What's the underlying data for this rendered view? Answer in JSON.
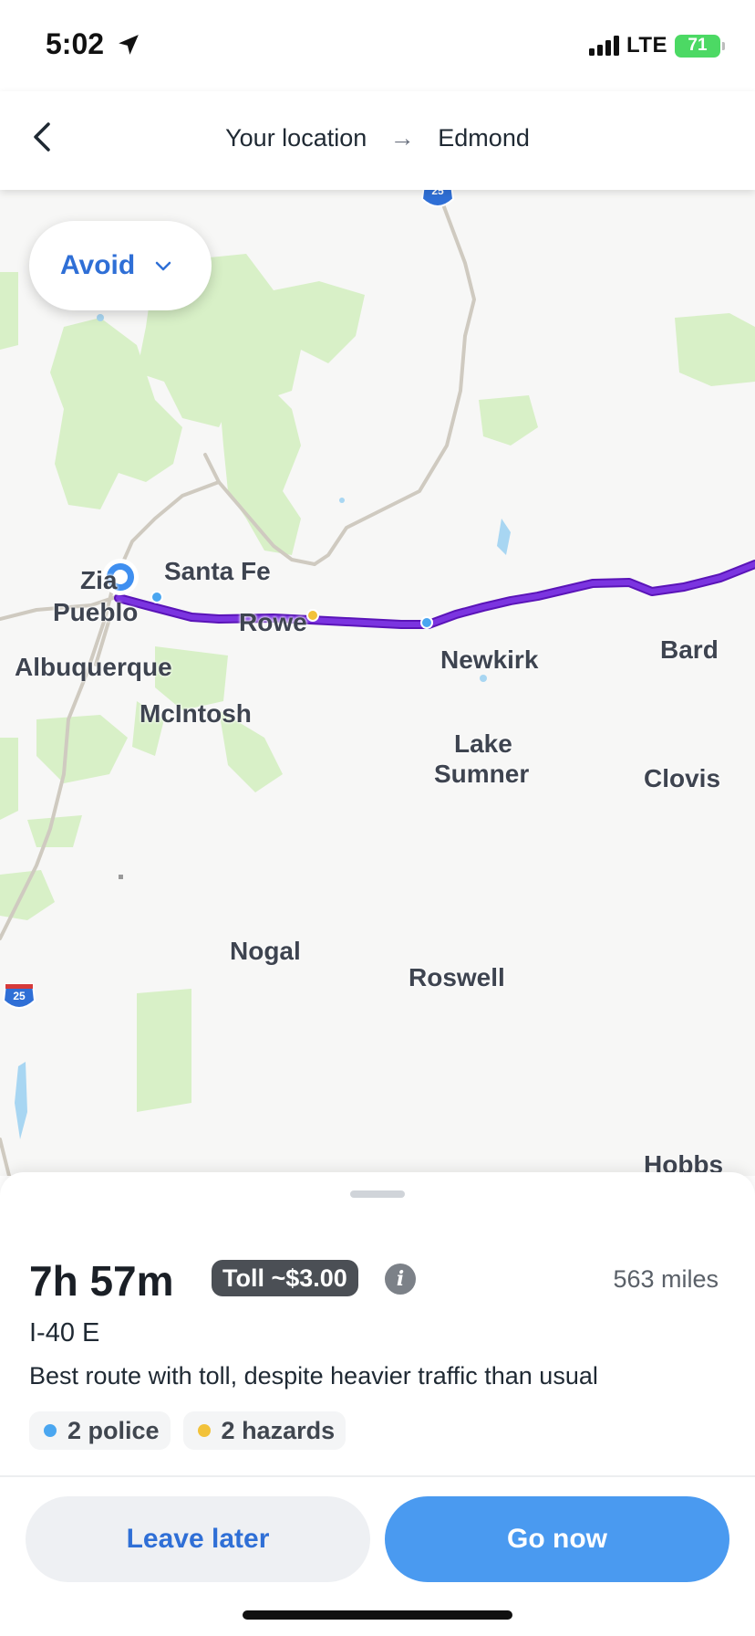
{
  "status": {
    "time": "5:02",
    "network": "LTE",
    "battery": "71"
  },
  "header": {
    "origin": "Your location",
    "arrow": "→",
    "destination": "Edmond"
  },
  "map": {
    "avoid_label": "Avoid",
    "highway_shield": "25",
    "labels": {
      "zia": "Zia",
      "pueblo": "Pueblo",
      "santa_fe": "Santa Fe",
      "rowe": "Rowe",
      "albuquerque": "Albuquerque",
      "newkirk": "Newkirk",
      "bard": "Bard",
      "mcintosh": "McIntosh",
      "lake": "Lake",
      "sumner": "Sumner",
      "clovis": "Clovis",
      "nogal": "Nogal",
      "roswell": "Roswell",
      "hobbs": "Hobbs"
    },
    "colors": {
      "route": "#6a1fd1",
      "forest": "#d8f0c7",
      "road": "#cfcac0",
      "water": "#a8d6f2"
    }
  },
  "route": {
    "duration": "7h 57m",
    "toll": "Toll ~$3.00",
    "distance": "563 miles",
    "highway": "I-40 E",
    "description": "Best route with toll, despite heavier traffic than usual",
    "chips": [
      {
        "label": "2 police",
        "color": "#4aa6f0"
      },
      {
        "label": "2 hazards",
        "color": "#f2c23a"
      }
    ]
  },
  "actions": {
    "leave_later": "Leave later",
    "go_now": "Go now"
  }
}
